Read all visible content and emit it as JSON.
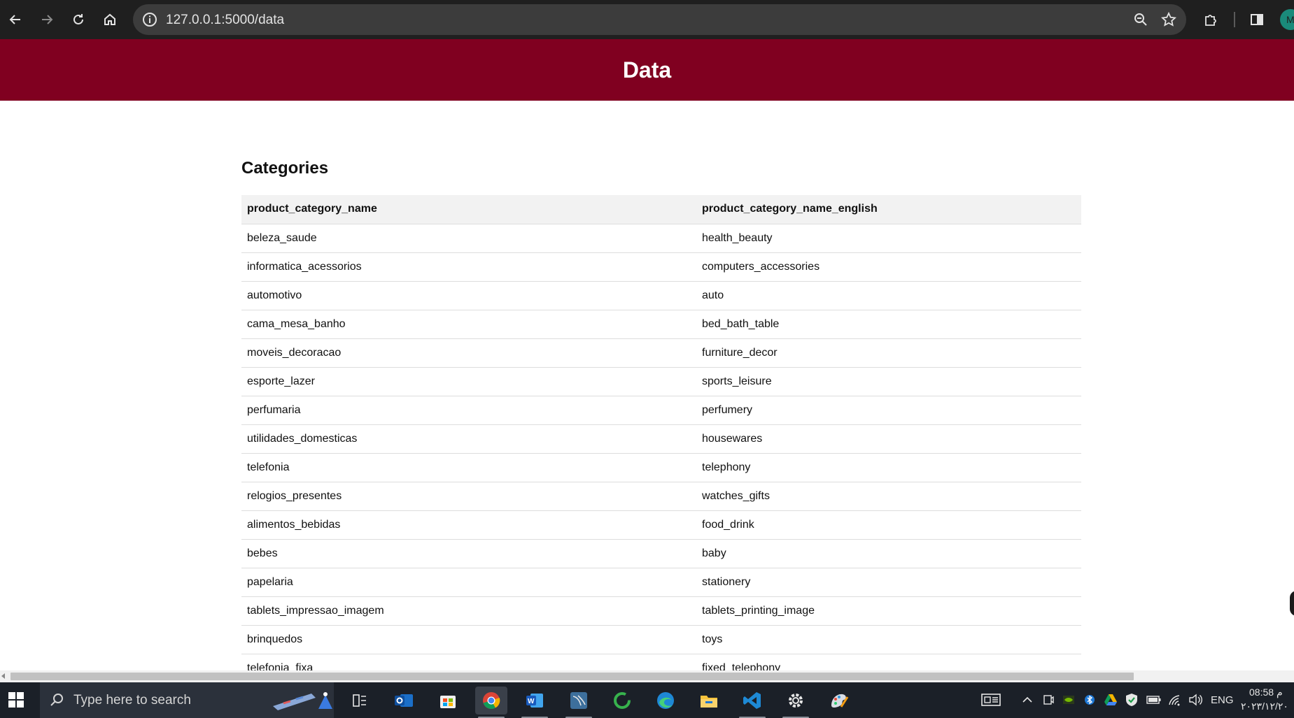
{
  "browser": {
    "url": "127.0.0.1:5000/data",
    "profile_initial": "M",
    "colors": {
      "chrome_bg": "#1f1f1f",
      "omnibox_bg": "#3c3c3c"
    }
  },
  "page": {
    "header_title": "Data",
    "header_color": "#800020",
    "section_title": "Categories",
    "table": {
      "columns": [
        "product_category_name",
        "product_category_name_english"
      ],
      "rows": [
        [
          "beleza_saude",
          "health_beauty"
        ],
        [
          "informatica_acessorios",
          "computers_accessories"
        ],
        [
          "automotivo",
          "auto"
        ],
        [
          "cama_mesa_banho",
          "bed_bath_table"
        ],
        [
          "moveis_decoracao",
          "furniture_decor"
        ],
        [
          "esporte_lazer",
          "sports_leisure"
        ],
        [
          "perfumaria",
          "perfumery"
        ],
        [
          "utilidades_domesticas",
          "housewares"
        ],
        [
          "telefonia",
          "telephony"
        ],
        [
          "relogios_presentes",
          "watches_gifts"
        ],
        [
          "alimentos_bebidas",
          "food_drink"
        ],
        [
          "bebes",
          "baby"
        ],
        [
          "papelaria",
          "stationery"
        ],
        [
          "tablets_impressao_imagem",
          "tablets_printing_image"
        ],
        [
          "brinquedos",
          "toys"
        ],
        [
          "telefonia_fixa",
          "fixed_telephony"
        ]
      ]
    }
  },
  "taskbar": {
    "search_placeholder": "Type here to search",
    "apps": [
      "task-view",
      "outlook",
      "microsoft-store",
      "chrome",
      "word",
      "mysql-workbench",
      "app-green-ring",
      "edge",
      "file-explorer",
      "vs-code",
      "settings",
      "paint"
    ],
    "language": "ENG",
    "time": "08:58 م",
    "date": "٢٠٢٣/١٢/٢٠"
  }
}
